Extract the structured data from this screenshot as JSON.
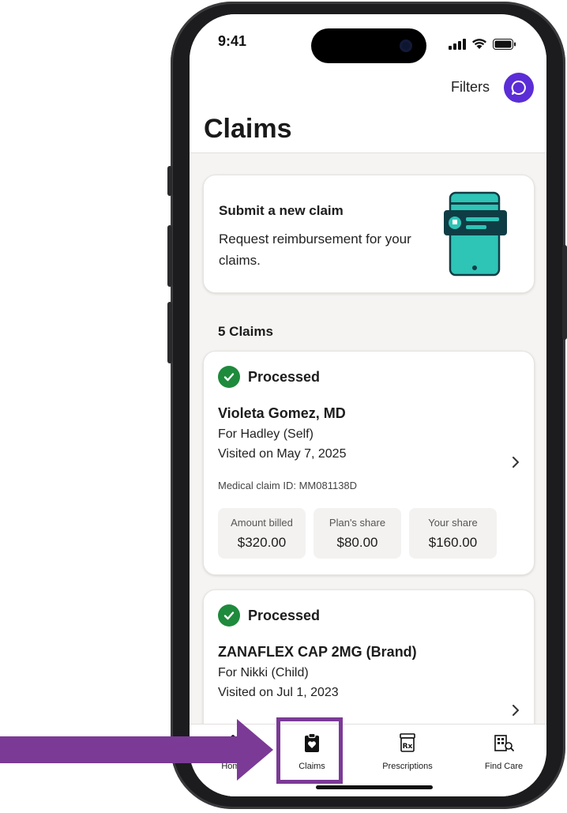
{
  "status_bar": {
    "time": "9:41"
  },
  "header": {
    "filters_label": "Filters",
    "title": "Claims"
  },
  "submit_card": {
    "title": "Submit a new claim",
    "description": "Request reimbursement for your claims."
  },
  "claims_count": "5 Claims",
  "claims": [
    {
      "status": "Processed",
      "provider": "Violeta Gomez, MD",
      "for": "For Hadley (Self)",
      "visited": "Visited on May 7, 2025",
      "claim_id": "Medical claim ID: MM081138D",
      "amounts": [
        {
          "label": "Amount billed",
          "value": "$320.00"
        },
        {
          "label": "Plan's share",
          "value": "$80.00"
        },
        {
          "label": "Your share",
          "value": "$160.00"
        }
      ]
    },
    {
      "status": "Processed",
      "provider": "ZANAFLEX CAP 2MG (Brand)",
      "for": "For Nikki (Child)",
      "visited": "Visited on Jul 1, 2023"
    }
  ],
  "tab_bar": {
    "tabs": [
      {
        "label": "Home",
        "icon": "home-icon"
      },
      {
        "label": "Claims",
        "icon": "clipboard-heart-icon"
      },
      {
        "label": "Prescriptions",
        "icon": "rx-bottle-icon"
      },
      {
        "label": "Find Care",
        "icon": "building-search-icon"
      }
    ]
  },
  "colors": {
    "accent": "#5b2dd6",
    "success": "#1e8a3c",
    "annotation": "#7b3a96",
    "illustration_teal": "#2ec4b6",
    "illustration_dark": "#0f3d45"
  }
}
